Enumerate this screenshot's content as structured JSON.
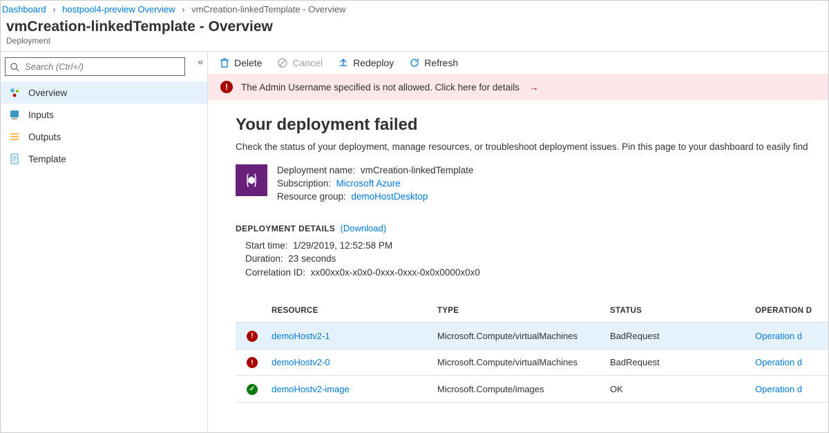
{
  "breadcrumb": {
    "items": [
      {
        "label": "Dashboard",
        "current": false
      },
      {
        "label": "hostpool4-preview Overview",
        "current": false
      },
      {
        "label": "vmCreation-linkedTemplate - Overview",
        "current": true
      }
    ]
  },
  "header": {
    "title": "vmCreation-linkedTemplate - Overview",
    "subtitle": "Deployment"
  },
  "sidebar": {
    "search_placeholder": "Search (Ctrl+/)",
    "items": [
      {
        "label": "Overview",
        "icon": "overview",
        "selected": true
      },
      {
        "label": "Inputs",
        "icon": "inputs",
        "selected": false
      },
      {
        "label": "Outputs",
        "icon": "outputs",
        "selected": false
      },
      {
        "label": "Template",
        "icon": "template",
        "selected": false
      }
    ]
  },
  "toolbar": {
    "delete": "Delete",
    "cancel": "Cancel",
    "redeploy": "Redeploy",
    "refresh": "Refresh"
  },
  "banner": {
    "text": "The Admin Username specified is not allowed. Click here for details"
  },
  "deployment": {
    "status_title": "Your deployment failed",
    "description": "Check the status of your deployment, manage resources, or troubleshoot deployment issues. Pin this page to your dashboard to easily find ",
    "name_label": "Deployment name:",
    "name_value": "vmCreation-linkedTemplate",
    "subscription_label": "Subscription:",
    "subscription_value": "Microsoft Azure",
    "rg_label": "Resource group:",
    "rg_value": "demoHostDesktop",
    "details_title": "DEPLOYMENT DETAILS",
    "download_label": "(Download)",
    "start_label": "Start time:",
    "start_value": "1/29/2019, 12:52:58 PM",
    "duration_label": "Duration:",
    "duration_value": "23 seconds",
    "corr_label": "Correlation ID:",
    "corr_value": "xx00xx0x-x0x0-0xxx-0xxx-0x0x0000x0x0"
  },
  "table": {
    "headers": {
      "resource": "RESOURCE",
      "type": "TYPE",
      "status": "STATUS",
      "operation": "OPERATION D"
    },
    "rows": [
      {
        "status_icon": "err",
        "resource": "demoHostv2-1",
        "type": "Microsoft.Compute/virtualMachines",
        "status": "BadRequest",
        "op": "Operation d",
        "selected": true
      },
      {
        "status_icon": "err",
        "resource": "demoHostv2-0",
        "type": "Microsoft.Compute/virtualMachines",
        "status": "BadRequest",
        "op": "Operation d",
        "selected": false
      },
      {
        "status_icon": "ok",
        "resource": "demoHostv2-image",
        "type": "Microsoft.Compute/images",
        "status": "OK",
        "op": "Operation d",
        "selected": false
      }
    ]
  }
}
